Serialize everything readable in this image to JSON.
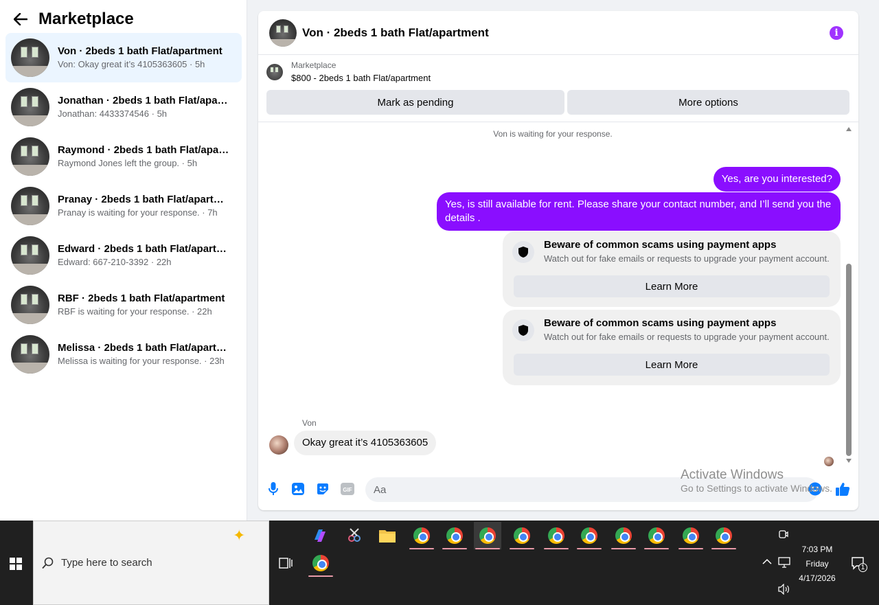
{
  "sidebar": {
    "title": "Marketplace",
    "conversations": [
      {
        "title": "Von · 2beds 1 bath Flat/apartment",
        "subtitle": "Von: Okay great it’s 4105363605 · 5h"
      },
      {
        "title": "Jonathan · 2beds 1 bath Flat/apart...",
        "subtitle": "Jonathan: 4433374546 · 5h"
      },
      {
        "title": "Raymond · 2beds 1 bath Flat/apart...",
        "subtitle": "Raymond Jones left the group. · 5h"
      },
      {
        "title": "Pranay · 2beds 1 bath Flat/apartm...",
        "subtitle": "Pranay is waiting for your response. · 7h"
      },
      {
        "title": "Edward · 2beds 1 bath Flat/apartm...",
        "subtitle": "Edward: 667-210-3392 · 22h"
      },
      {
        "title": "RBF · 2beds 1 bath Flat/apartment",
        "subtitle": "RBF is waiting for your response. · 22h"
      },
      {
        "title": "Melissa · 2beds 1 bath Flat/apartm...",
        "subtitle": "Melissa is waiting for your response. · 23h"
      }
    ]
  },
  "chat": {
    "title": "Von · 2beds 1 bath Flat/apartment",
    "listing_source": "Marketplace",
    "listing_price": "$800 - 2beds 1 bath Flat/apartment",
    "mark_pending": "Mark as pending",
    "more_options": "More options",
    "waiting_notice": "Von is waiting for your response.",
    "outgoing": [
      "Yes, are you interested?",
      "Yes, is still available for rent. Please share your contact number, and I’ll send you the details ."
    ],
    "scam_cards": [
      {
        "title": "Beware of common scams using payment apps",
        "desc": "Watch out for fake emails or requests to upgrade your payment account.",
        "button": "Learn More"
      },
      {
        "title": "Beware of common scams using payment apps",
        "desc": "Watch out for fake emails or requests to upgrade your payment account.",
        "button": "Learn More"
      }
    ],
    "incoming_sender": "Von",
    "incoming_message": "Okay great it’s 4105363605",
    "input_placeholder": "Aa"
  },
  "watermark": {
    "title": "Activate Windows",
    "subtitle": "Go to Settings to activate Windows."
  },
  "taskbar": {
    "search_placeholder": "Type here to search",
    "time": "7:03 PM",
    "day": "Friday",
    "date": "4/17/2026",
    "notification_count": "1"
  },
  "colors": {
    "accent": "#8a0eff",
    "active_conversation": "#ebf5ff",
    "like": "#0a7cff"
  }
}
